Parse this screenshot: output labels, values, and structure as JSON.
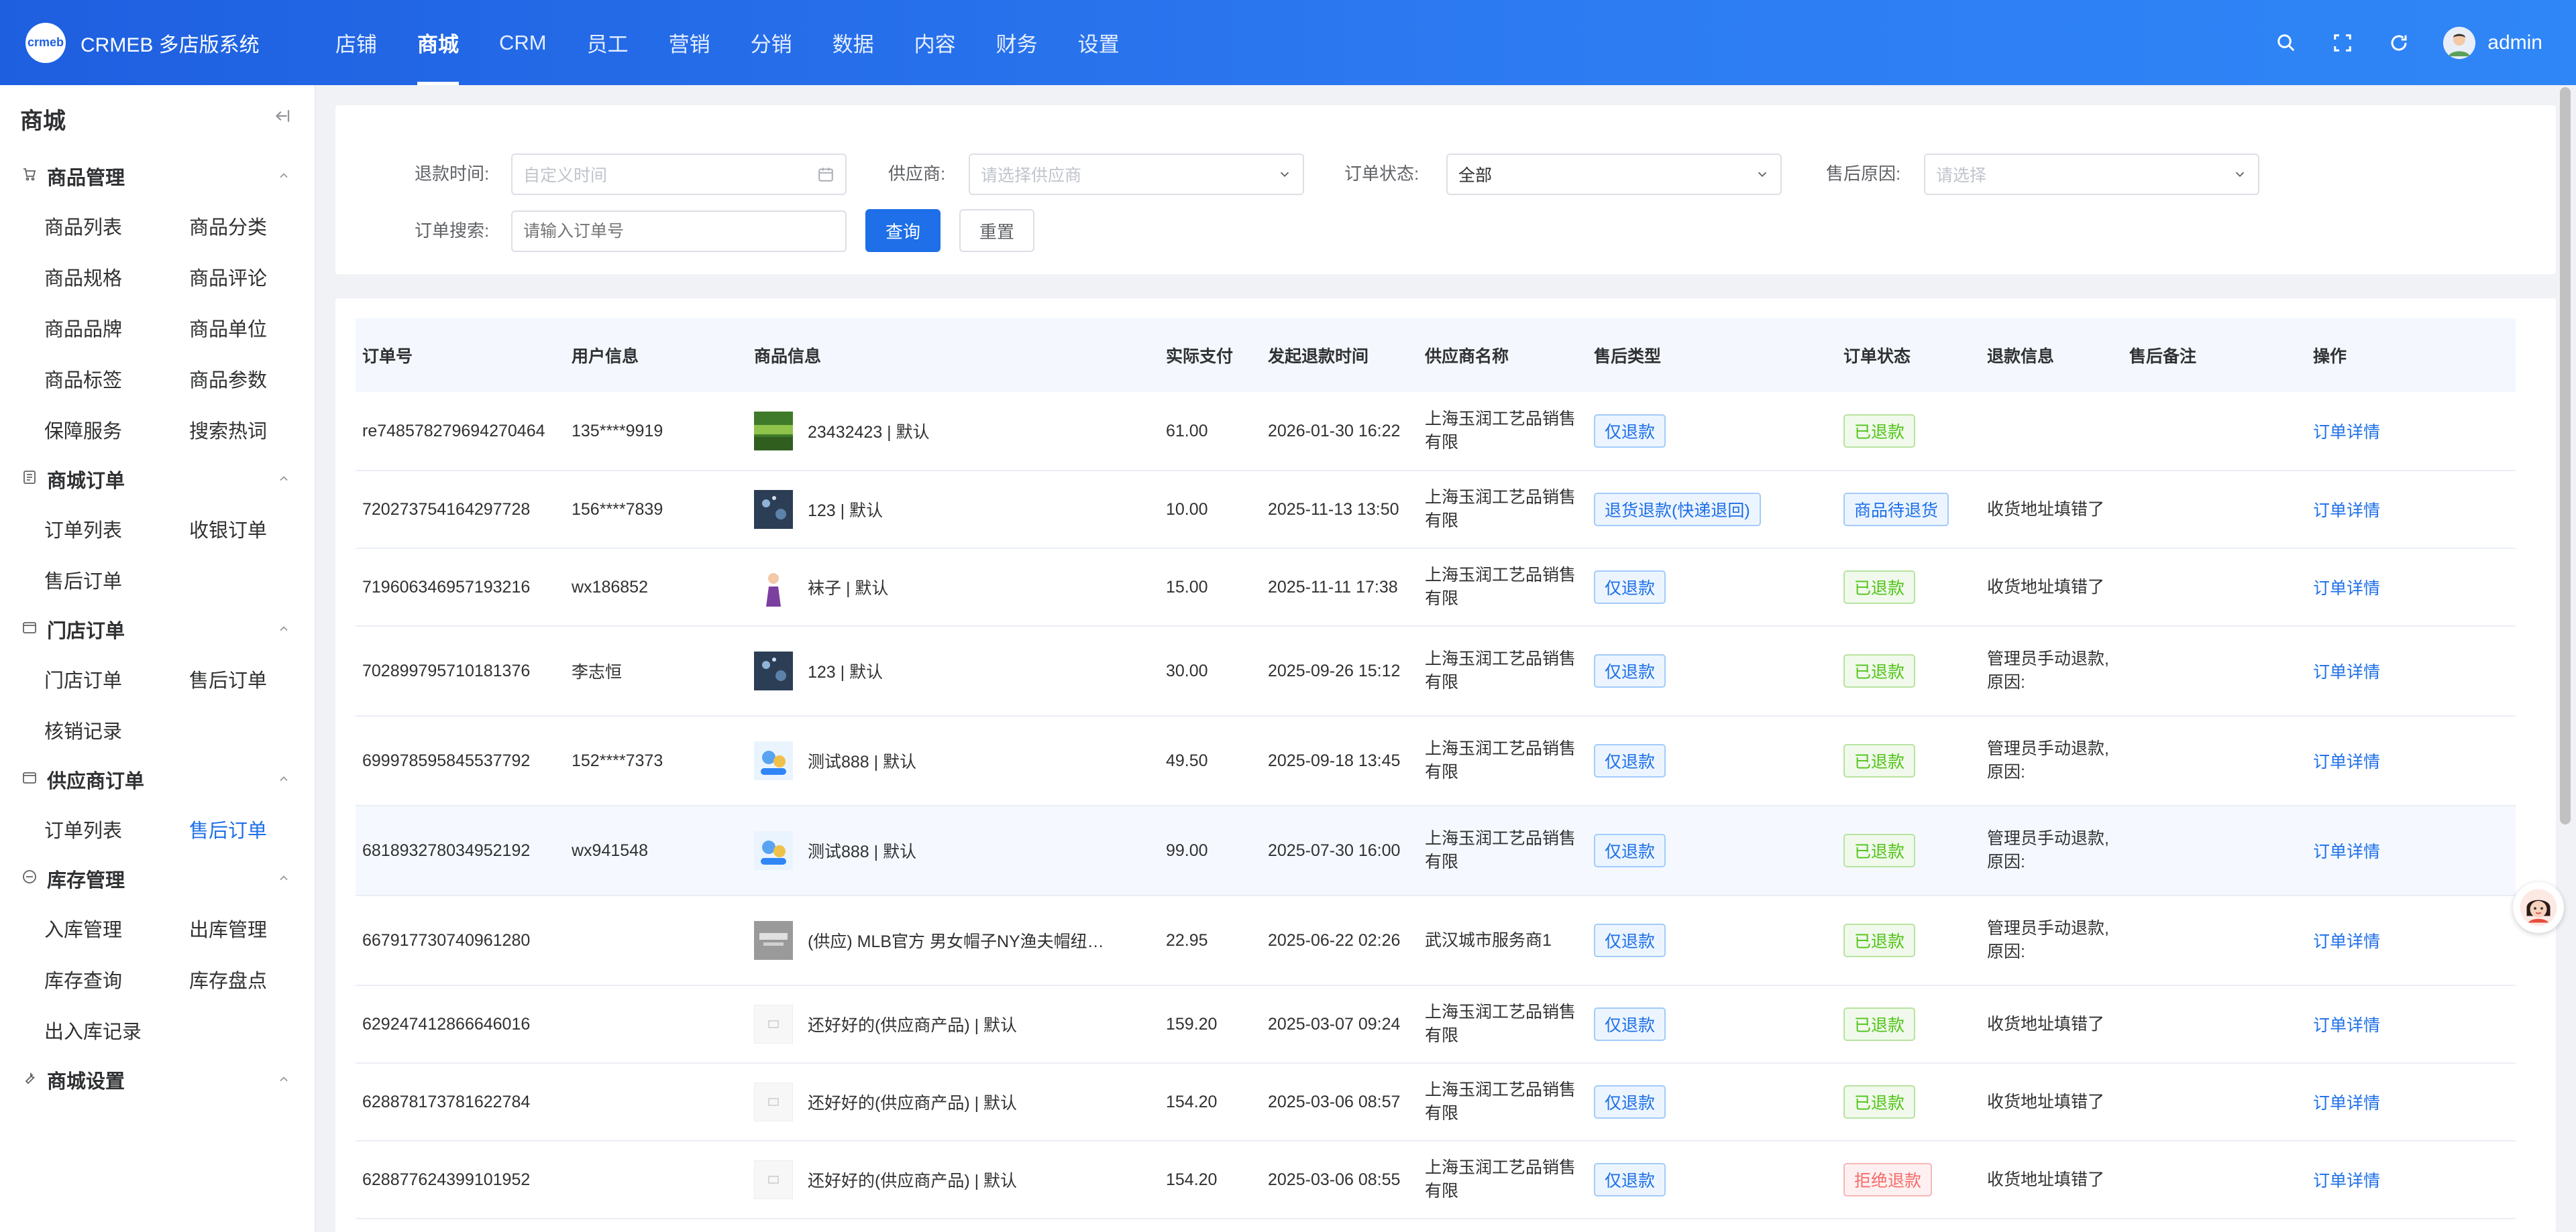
{
  "app": {
    "logo_mark": "crmeb",
    "title": "CRMEB 多店版系统"
  },
  "nav": [
    {
      "label": "店铺"
    },
    {
      "label": "商城"
    },
    {
      "label": "CRM"
    },
    {
      "label": "员工"
    },
    {
      "label": "营销"
    },
    {
      "label": "分销"
    },
    {
      "label": "数据"
    },
    {
      "label": "内容"
    },
    {
      "label": "财务"
    },
    {
      "label": "设置"
    }
  ],
  "user": {
    "name": "admin"
  },
  "sidebar": {
    "title": "商城",
    "groups": [
      {
        "title": "商品管理",
        "icon": "cart-icon",
        "items": [
          "商品列表",
          "商品分类",
          "商品规格",
          "商品评论",
          "商品品牌",
          "商品单位",
          "商品标签",
          "商品参数",
          "保障服务",
          "搜索热词"
        ]
      },
      {
        "title": "商城订单",
        "icon": "doc-icon",
        "items": [
          "订单列表",
          "收银订单",
          "售后订单"
        ]
      },
      {
        "title": "门店订单",
        "icon": "box-icon",
        "items": [
          "门店订单",
          "售后订单",
          "核销记录"
        ]
      },
      {
        "title": "供应商订单",
        "icon": "box-icon",
        "items": [
          "订单列表",
          "售后订单"
        ]
      },
      {
        "title": "库存管理",
        "icon": "stock-icon",
        "items": [
          "入库管理",
          "出库管理",
          "库存查询",
          "库存盘点",
          "出入库记录"
        ]
      },
      {
        "title": "商城设置",
        "icon": "wrench-icon",
        "items": []
      }
    ]
  },
  "filter": {
    "refund_time_label": "退款时间:",
    "refund_time_placeholder": "自定义时间",
    "supplier_label": "供应商:",
    "supplier_placeholder": "请选择供应商",
    "status_label": "订单状态:",
    "status_value": "全部",
    "reason_label": "售后原因:",
    "reason_placeholder": "请选择",
    "search_label": "订单搜索:",
    "search_placeholder": "请输入订单号",
    "query_button": "查询",
    "reset_button": "重置"
  },
  "table": {
    "headers": [
      "订单号",
      "用户信息",
      "商品信息",
      "实际支付",
      "发起退款时间",
      "供应商名称",
      "售后类型",
      "订单状态",
      "退款信息",
      "售后备注",
      "操作"
    ],
    "rows": [
      {
        "order": "re748578279694270464",
        "user": "135****9919",
        "product": "23432423 | 默认",
        "pay": "61.00",
        "time": "2026-01-30 16:22",
        "supplier": "上海玉润工艺品销售有限",
        "type": "仅退款",
        "status": "已退款",
        "status_kind": "green",
        "info": "",
        "remark": "",
        "action": "订单详情",
        "thumb": "green"
      },
      {
        "order": "720273754164297728",
        "user": "156****7839",
        "product": "123 | 默认",
        "pay": "10.00",
        "time": "2025-11-13 13:50",
        "supplier": "上海玉润工艺品销售有限",
        "type": "退货退款(快递退回)",
        "status": "商品待退货",
        "status_kind": "blue",
        "info": "收货地址填错了",
        "remark": "",
        "action": "订单详情",
        "thumb": "dark"
      },
      {
        "order": "719606346957193216",
        "user": "wx186852",
        "product": "袜子 | 默认",
        "pay": "15.00",
        "time": "2025-11-11 17:38",
        "supplier": "上海玉润工艺品销售有限",
        "type": "仅退款",
        "status": "已退款",
        "status_kind": "green",
        "info": "收货地址填错了",
        "remark": "",
        "action": "订单详情",
        "thumb": "person"
      },
      {
        "order": "702899795710181376",
        "user": "李志恒",
        "product": "123 | 默认",
        "pay": "30.00",
        "time": "2025-09-26 15:12",
        "supplier": "上海玉润工艺品销售有限",
        "type": "仅退款",
        "status": "已退款",
        "status_kind": "green",
        "info": "管理员手动退款,原因:",
        "remark": "",
        "action": "订单详情",
        "thumb": "dark"
      },
      {
        "order": "699978595845537792",
        "user": "152****7373",
        "product": "测试888 | 默认",
        "pay": "49.50",
        "time": "2025-09-18 13:45",
        "supplier": "上海玉润工艺品销售有限",
        "type": "仅退款",
        "status": "已退款",
        "status_kind": "green",
        "info": "管理员手动退款,原因:",
        "remark": "",
        "action": "订单详情",
        "thumb": "cartoon"
      },
      {
        "order": "681893278034952192",
        "user": "wx941548",
        "product": "测试888 | 默认",
        "pay": "99.00",
        "time": "2025-07-30 16:00",
        "supplier": "上海玉润工艺品销售有限",
        "type": "仅退款",
        "status": "已退款",
        "status_kind": "green",
        "info": "管理员手动退款,原因:",
        "remark": "",
        "action": "订单详情",
        "thumb": "cartoon"
      },
      {
        "order": "667917730740961280",
        "user": "",
        "product": "(供应) MLB官方 男女帽子NY渔夫帽纽…",
        "pay": "22.95",
        "time": "2025-06-22 02:26",
        "supplier": "武汉城市服务商1",
        "type": "仅退款",
        "status": "已退款",
        "status_kind": "green",
        "info": "管理员手动退款,原因:",
        "remark": "",
        "action": "订单详情",
        "thumb": "gray"
      },
      {
        "order": "629247412866646016",
        "user": "",
        "product": "还好好的(供应商产品) | 默认",
        "pay": "159.20",
        "time": "2025-03-07 09:24",
        "supplier": "上海玉润工艺品销售有限",
        "type": "仅退款",
        "status": "已退款",
        "status_kind": "green",
        "info": "收货地址填错了",
        "remark": "",
        "action": "订单详情",
        "thumb": "blank"
      },
      {
        "order": "628878173781622784",
        "user": "",
        "product": "还好好的(供应商产品) | 默认",
        "pay": "154.20",
        "time": "2025-03-06 08:57",
        "supplier": "上海玉润工艺品销售有限",
        "type": "仅退款",
        "status": "已退款",
        "status_kind": "green",
        "info": "收货地址填错了",
        "remark": "",
        "action": "订单详情",
        "thumb": "blank"
      },
      {
        "order": "628877624399101952",
        "user": "",
        "product": "还好好的(供应商产品) | 默认",
        "pay": "154.20",
        "time": "2025-03-06 08:55",
        "supplier": "上海玉润工艺品销售有限",
        "type": "仅退款",
        "status": "拒绝退款",
        "status_kind": "red",
        "info": "收货地址填错了",
        "remark": "",
        "action": "订单详情",
        "thumb": "blank"
      }
    ]
  },
  "colors": {
    "primary": "#1e6fe8",
    "topbar": "#2d7bf2",
    "success": "#52c41a",
    "danger": "#f56c6c"
  }
}
